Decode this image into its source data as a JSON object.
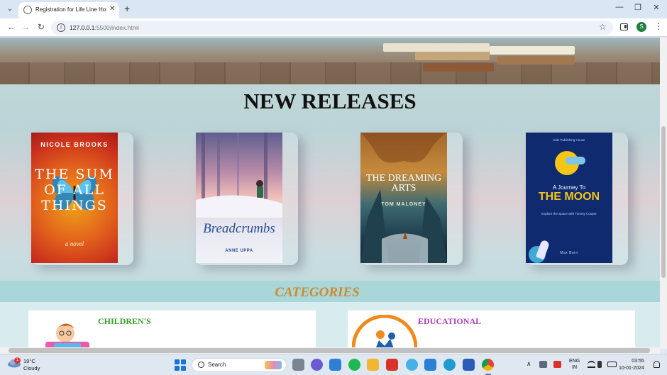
{
  "browser": {
    "tab_title": "Registration for Life Line Hospi",
    "tab_close": "✕",
    "new_tab": "+",
    "url_host": "127.0.0.1",
    "url_rest": ":5500/index.html",
    "profile_initial": "S",
    "window_controls": [
      "—",
      "❐",
      "✕"
    ]
  },
  "page": {
    "releases_heading": "NEW RELEASES",
    "books": [
      {
        "author": "NICOLE BROOKS",
        "title": "THE SUM OF ALL THINGS",
        "subtitle": "a novel"
      },
      {
        "author": "ANNE UPPA",
        "title": "Breadcrumbs"
      },
      {
        "author": "TOM MALONEY",
        "title": "THE DREAMING ARTS"
      },
      {
        "publisher": "Kids Publishing House",
        "kicker": "A Journey To",
        "title": "THE MOON",
        "tagline": "Explore the Space with Tommy Cooper",
        "author": "Max Born"
      }
    ],
    "categories_heading": "CATEGORIES",
    "categories": [
      {
        "label": "CHILDREN'S",
        "color": "#3a9d2a"
      },
      {
        "label": "EDUCATIONAL",
        "color": "#b23bb8"
      }
    ]
  },
  "taskbar": {
    "weather_temp": "19°C",
    "weather_desc": "Cloudy",
    "notification_count": "1",
    "search_label": "Search",
    "language": "ENG",
    "region": "IN",
    "time": "03:55",
    "date": "10-01-2024"
  }
}
